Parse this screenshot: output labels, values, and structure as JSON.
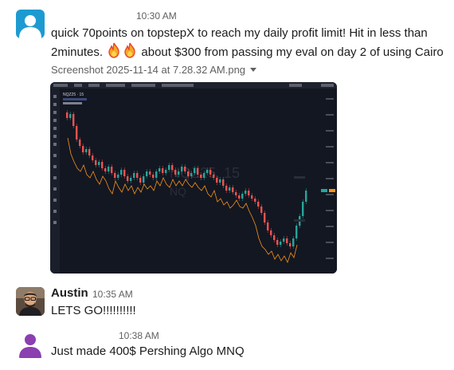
{
  "messages": [
    {
      "avatar": "default-user-avatar-blue",
      "time": "10:30 AM",
      "text_line1_a": "quick 70points on topstepX to reach my daily profit limit! Hit in less than",
      "text_line2_a": "2minutes.",
      "text_line2_b": "about $300 from passing my eval on day 2 of using Cairo",
      "emoji": [
        "fire-emoji",
        "fire-emoji"
      ],
      "attachment": {
        "filename": "Screenshot 2025-11-14 at 7.28.32 AM.png",
        "toggle_icon": "caret-down-icon",
        "preview": {
          "symbol": "NQZ25 · 15",
          "watermark_line1": "NQZ25, 15",
          "watermark_line2": "NQ"
        }
      }
    },
    {
      "author": "Austin",
      "avatar": "austin-photo-avatar",
      "time": "10:35 AM",
      "text": "LETS GO!!!!!!!!!!"
    },
    {
      "avatar": "default-user-avatar-purple",
      "time": "10:38 AM",
      "text": "Just made 400$ Pershing Algo MNQ"
    }
  ],
  "colors": {
    "text": "#1d1c1d",
    "muted": "#616061",
    "avatar_blue": "#1d9bd1",
    "avatar_purple": "#8b3fb0",
    "chart_bg": "#131722",
    "candle_up": "#26a69a",
    "candle_down": "#ef5350",
    "line_orange": "#f7931a"
  }
}
